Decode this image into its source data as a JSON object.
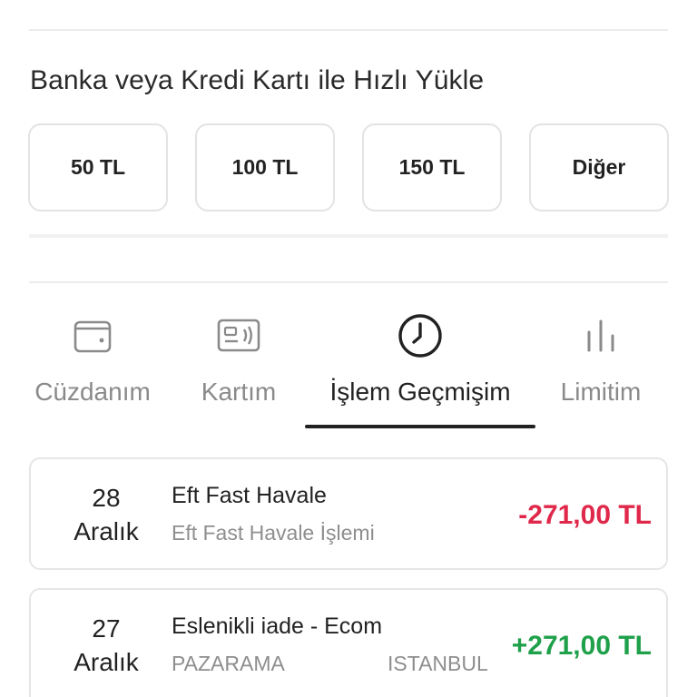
{
  "quick_load": {
    "title": "Banka veya Kredi Kartı ile Hızlı Yükle",
    "amounts": [
      {
        "label": "50 TL"
      },
      {
        "label": "100 TL"
      },
      {
        "label": "150 TL"
      },
      {
        "label": "Diğer"
      }
    ]
  },
  "tabs": [
    {
      "label": "Cüzdanım",
      "icon": "wallet-icon",
      "active": false
    },
    {
      "label": "Kartım",
      "icon": "contactless-card-icon",
      "active": false
    },
    {
      "label": "İşlem Geçmişim",
      "icon": "clock-icon",
      "active": true
    },
    {
      "label": "Limitim",
      "icon": "bar-chart-icon",
      "active": false
    }
  ],
  "transactions": [
    {
      "day": "28",
      "month": "Aralık",
      "title": "Eft Fast Havale",
      "subtitle": "Eft Fast Havale İşlemi",
      "city": "",
      "amount": "-271,00 TL",
      "amount_color": "#e0284a"
    },
    {
      "day": "27",
      "month": "Aralık",
      "title": "Eslenikli iade - Ecom",
      "subtitle": "PAZARAMA",
      "city": "ISTANBUL",
      "amount": "+271,00 TL",
      "amount_color": "#1fa04a"
    }
  ],
  "colors": {
    "negative": "#e0284a",
    "positive": "#1fa04a",
    "inactive_tab": "#8a8a8a",
    "active_tab": "#222222"
  }
}
